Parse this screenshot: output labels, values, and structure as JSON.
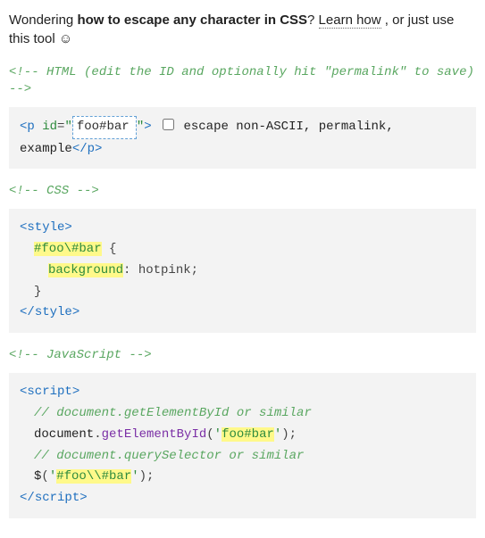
{
  "intro": {
    "prefix": "Wondering ",
    "bold": "how to escape any character in CSS",
    "q": "? ",
    "learn_how": "Learn how",
    "tail": " , or just use this tool ☺"
  },
  "html": {
    "comment": "<!-- HTML (edit the ID and optionally hit \"permalink\" to save) -->",
    "tag_open": "<",
    "tag_name": "p",
    "attr_id_name": "id",
    "eq": "=",
    "q1": "\"",
    "q2": "\"",
    "gt": ">",
    "id_value": "foo#bar",
    "cb_label": "escape non-ASCII",
    "sep1": ", ",
    "permalink": "permalink",
    "sep2": ", ",
    "example": "example",
    "tag_close_open": "</",
    "tag_close_gt": ">"
  },
  "css": {
    "comment": "<!-- CSS -->",
    "style_open_lt": "<",
    "style_name": "style",
    "style_open_gt": ">",
    "selector": "#foo\\#bar",
    "brace_open": "{",
    "prop": "background",
    "colon": ":",
    "value": "hotpink",
    "semi": ";",
    "brace_close": "}",
    "style_close_lt": "</",
    "style_close_gt": ">"
  },
  "js": {
    "comment": "<!-- JavaScript -->",
    "script_open_lt": "<",
    "script_name": "script",
    "script_open_gt": ">",
    "c1": "// document.getElementById or similar",
    "obj": "document",
    "dot": ".",
    "fn1": "getElementById",
    "paren_open": "(",
    "q": "'",
    "arg1": "foo#bar",
    "paren_close": ");",
    "c2": "// document.querySelector or similar",
    "jq": "$",
    "arg2": "#foo\\\\#bar",
    "script_close_lt": "</",
    "script_close_gt": ">"
  }
}
